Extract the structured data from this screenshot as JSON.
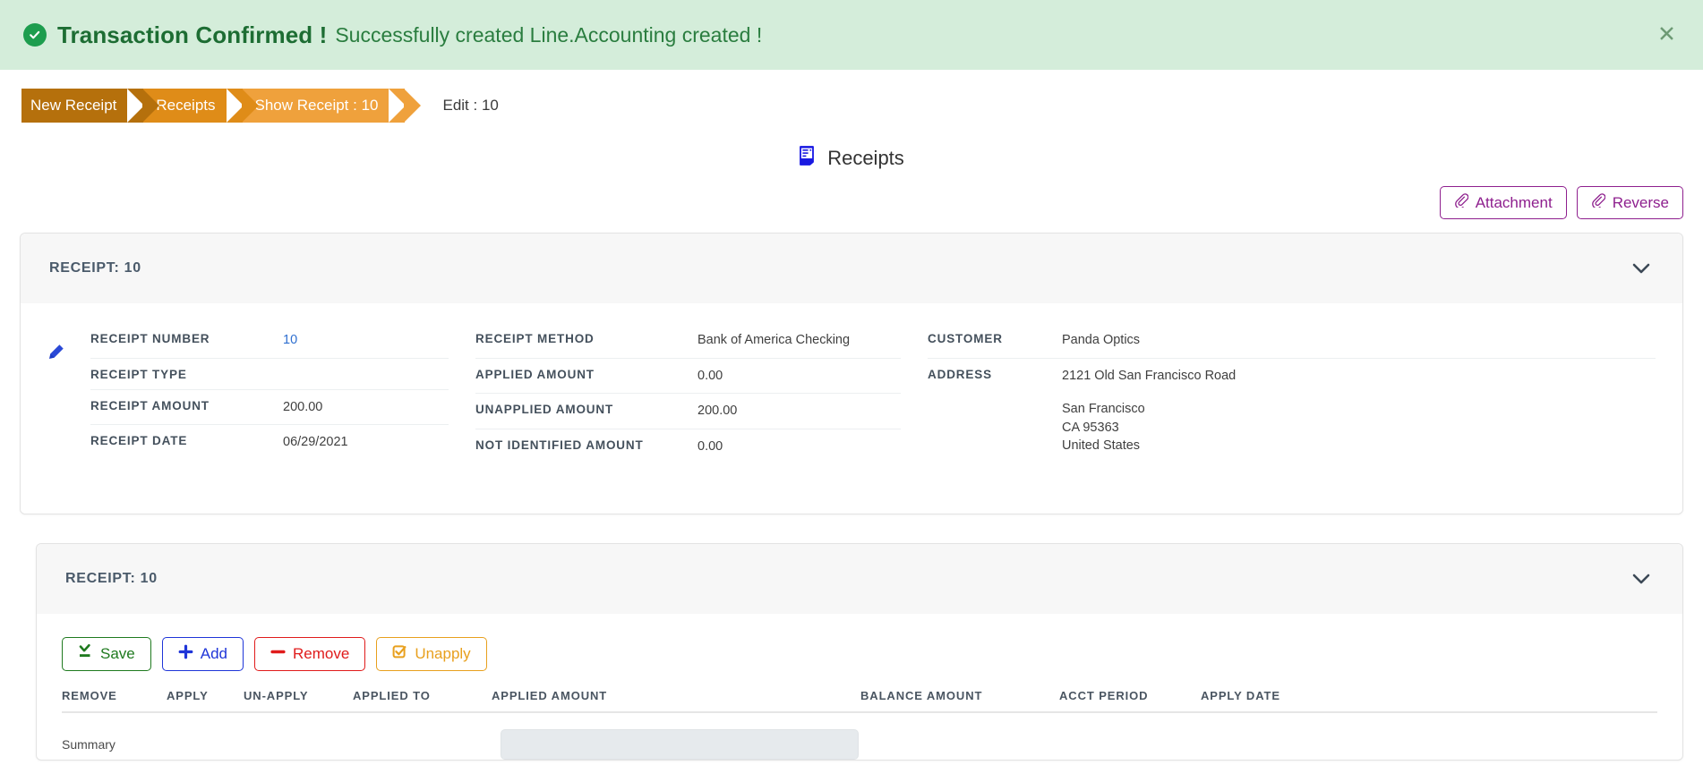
{
  "alert": {
    "icon": "check-circle-icon",
    "strong": "Transaction Confirmed !",
    "message": "Successfully created Line.Accounting created !",
    "close_label": "✕",
    "bg_color": "#d4edda",
    "text_color": "#1d6d33"
  },
  "breadcrumb": {
    "items": [
      {
        "label": "New Receipt",
        "color": "#b5700c"
      },
      {
        "label": "Receipts",
        "color": "#df8c18"
      },
      {
        "label": "Show Receipt : 10",
        "color": "#efa13c"
      }
    ],
    "current": "Edit : 10"
  },
  "header": {
    "icon": "receipt-icon",
    "title": "Receipts"
  },
  "actions": [
    {
      "label": "Attachment",
      "icon": "paperclip-icon",
      "color": "#8e1f8e"
    },
    {
      "label": "Reverse",
      "icon": "paperclip-icon",
      "color": "#8e1f8e"
    }
  ],
  "receipt_panel": {
    "title": "RECEIPT: 10",
    "edit_icon": "pencil-icon",
    "collapse_icon": "chevron-down-icon",
    "column_a": [
      {
        "label": "RECEIPT NUMBER",
        "value": "10",
        "is_link": true
      },
      {
        "label": "RECEIPT TYPE",
        "value": ""
      },
      {
        "label": "RECEIPT AMOUNT",
        "value": "200.00"
      },
      {
        "label": "RECEIPT DATE",
        "value": "06/29/2021"
      }
    ],
    "column_b": [
      {
        "label": "RECEIPT METHOD",
        "value": "Bank of America Checking"
      },
      {
        "label": "APPLIED AMOUNT",
        "value": "0.00"
      },
      {
        "label": "UNAPPLIED AMOUNT",
        "value": "200.00"
      },
      {
        "label": "NOT IDENTIFIED AMOUNT",
        "value": "0.00"
      }
    ],
    "column_c": [
      {
        "label": "CUSTOMER",
        "value": "Panda Optics"
      },
      {
        "label": "ADDRESS",
        "value": "2121 Old San Francisco Road"
      }
    ],
    "address_extra": "San Francisco\nCA 95363\nUnited States"
  },
  "lines_panel": {
    "title": "RECEIPT: 10",
    "collapse_icon": "chevron-down-icon",
    "toolbar": [
      {
        "label": "Save",
        "icon": "save-icon",
        "color": "#1f7a1f"
      },
      {
        "label": "Add",
        "icon": "plus-icon",
        "color": "#1f35d8"
      },
      {
        "label": "Remove",
        "icon": "minus-icon",
        "color": "#e01b1b"
      },
      {
        "label": "Unapply",
        "icon": "checkbox-icon",
        "color": "#e8a01e"
      }
    ],
    "columns": [
      "REMOVE",
      "APPLY",
      "UN-APPLY",
      "APPLIED TO",
      "APPLIED AMOUNT",
      "BALANCE AMOUNT",
      "ACCT PERIOD",
      "APPLY DATE"
    ],
    "summary_row_label": "Summary"
  }
}
